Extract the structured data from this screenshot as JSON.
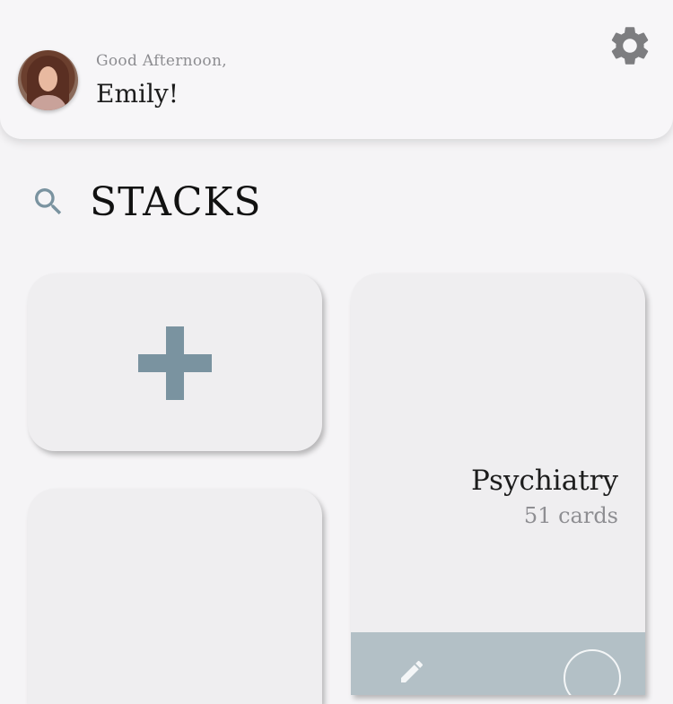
{
  "header": {
    "greeting": "Good Afternoon,",
    "user_name": "Emily!",
    "avatar_alt": "user profile photo",
    "settings_icon": "gear-icon"
  },
  "stacks_section": {
    "title": "STACKS",
    "search_icon": "search-icon"
  },
  "stacks": [
    {
      "type": "add",
      "icon": "plus-icon"
    },
    {
      "type": "stack",
      "name": "Psychiatry",
      "count": "51 cards",
      "actions": [
        "edit-icon",
        "circle-button"
      ]
    },
    {
      "type": "stack",
      "name": "",
      "count": ""
    }
  ],
  "colors": {
    "background": "#f5f4f6",
    "card": "#efeef0",
    "accent": "#7a93a0",
    "card_footer": "#b3c0c6",
    "icon_gray": "#7d7d80"
  }
}
